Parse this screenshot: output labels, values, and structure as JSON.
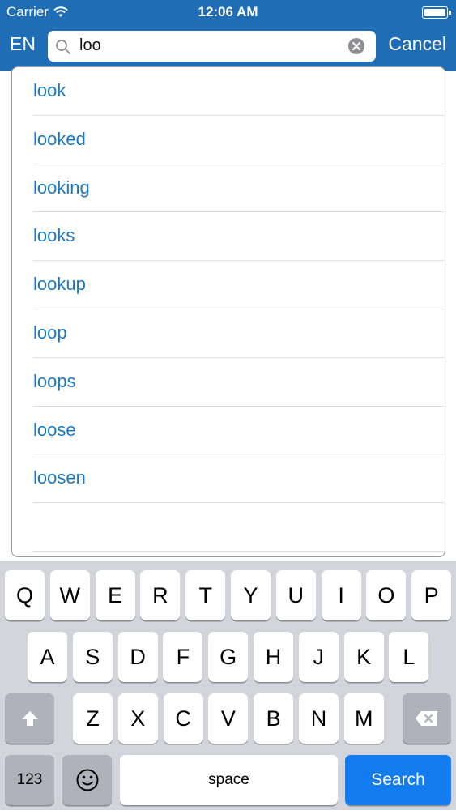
{
  "status": {
    "carrier": "Carrier",
    "time": "12:06 AM",
    "battery_level": 1.0
  },
  "nav": {
    "lang": "EN",
    "cancel": "Cancel"
  },
  "search": {
    "value": "loo"
  },
  "suggestions": [
    "look",
    "looked",
    "looking",
    "looks",
    "lookup",
    "loop",
    "loops",
    "loose",
    "loosen"
  ],
  "keyboard": {
    "row1": [
      "Q",
      "W",
      "E",
      "R",
      "T",
      "Y",
      "U",
      "I",
      "O",
      "P"
    ],
    "row2": [
      "A",
      "S",
      "D",
      "F",
      "G",
      "H",
      "J",
      "K",
      "L"
    ],
    "row3": [
      "Z",
      "X",
      "C",
      "V",
      "B",
      "N",
      "M"
    ],
    "numbers": "123",
    "space": "space",
    "search": "Search"
  },
  "colors": {
    "header": "#1f6db4",
    "link": "#1a78c2",
    "search_key": "#137cf0"
  }
}
